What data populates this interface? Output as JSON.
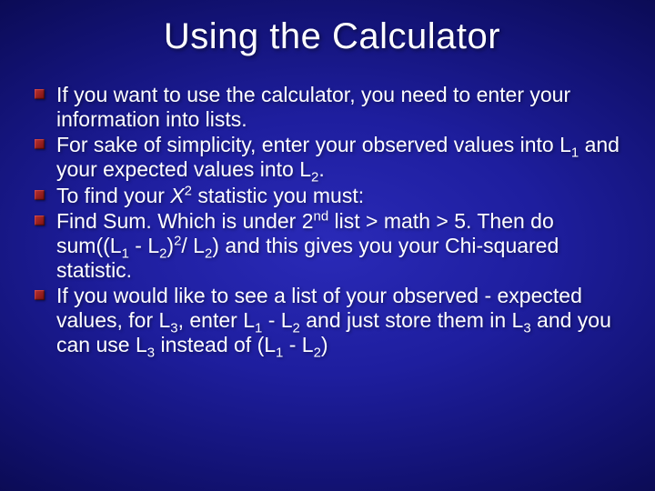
{
  "title": "Using the Calculator",
  "bullets": [
    {
      "html": "If you want to use the calculator, you need to enter your information into lists."
    },
    {
      "html": "For sake of simplicity, enter your observed values into L<sub>1</sub> and your expected values into L<sub>2</sub>."
    },
    {
      "html": "To find your <span class='chi'>X</span><sup>2</sup> statistic you must:"
    },
    {
      "html": "Find Sum. Which is under 2<sup>nd</sup> list &gt; math &gt; 5. Then do sum((L<sub>1</sub> - L<sub>2</sub>)<sup>2</sup>/ L<sub>2</sub>) and this gives you your Chi-squared statistic."
    },
    {
      "html": "If you would like to see a list of your observed - expected values, for L<sub>3</sub>, enter L<sub>1</sub> - L<sub>2</sub> and just store them in L<sub>3</sub> and you can use L<sub>3</sub> instead of (L<sub>1</sub> - L<sub>2</sub>)"
    }
  ]
}
